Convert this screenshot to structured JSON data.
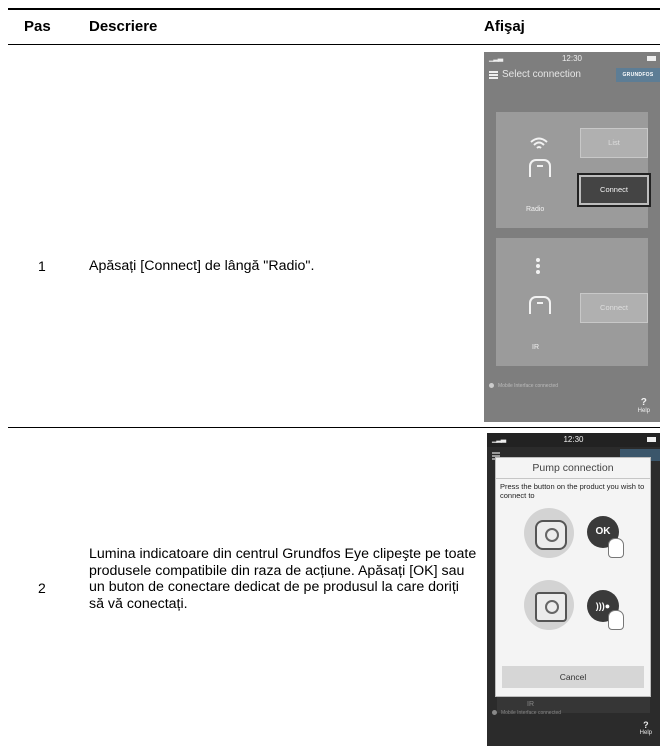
{
  "table": {
    "headers": {
      "pas": "Pas",
      "descriere": "Descriere",
      "afisaj": "Afişaj"
    },
    "rows": [
      {
        "step": "1",
        "description": "Apăsați [Connect] de lângă \"Radio\"."
      },
      {
        "step": "2",
        "description": "Lumina indicatoare din centrul Grundfos Eye clipeşte pe toate produsele compatibile din raza de acțiune. Apăsați [OK] sau un buton de conectare dedicat de pe produsul la care doriți să vă conectați."
      }
    ]
  },
  "screen1": {
    "status_time": "12:30",
    "title": "Select connection",
    "brand": "GRUNDFOS",
    "radio": {
      "label": "Radio",
      "list_button": "List",
      "connect_button": "Connect"
    },
    "ir": {
      "label": "IR",
      "connect_button": "Connect"
    },
    "mobile_interface": "Mobile Interface connected",
    "help_symbol": "?",
    "help_label": "Help"
  },
  "screen2": {
    "status_time": "12:30",
    "dialog_title": "Pump connection",
    "dialog_text": "Press the button on the product you wish to connect to",
    "ok_label": "OK",
    "cancel_button": "Cancel",
    "ir_label": "IR",
    "mobile_interface": "Mobile Interface connected",
    "help_symbol": "?",
    "help_label": "Help"
  },
  "colors": {
    "screen1_bg": "#7e7e7e",
    "screen2_bg": "#2b2b2b",
    "active_button": "#444444",
    "brand": "#5d7d95"
  }
}
